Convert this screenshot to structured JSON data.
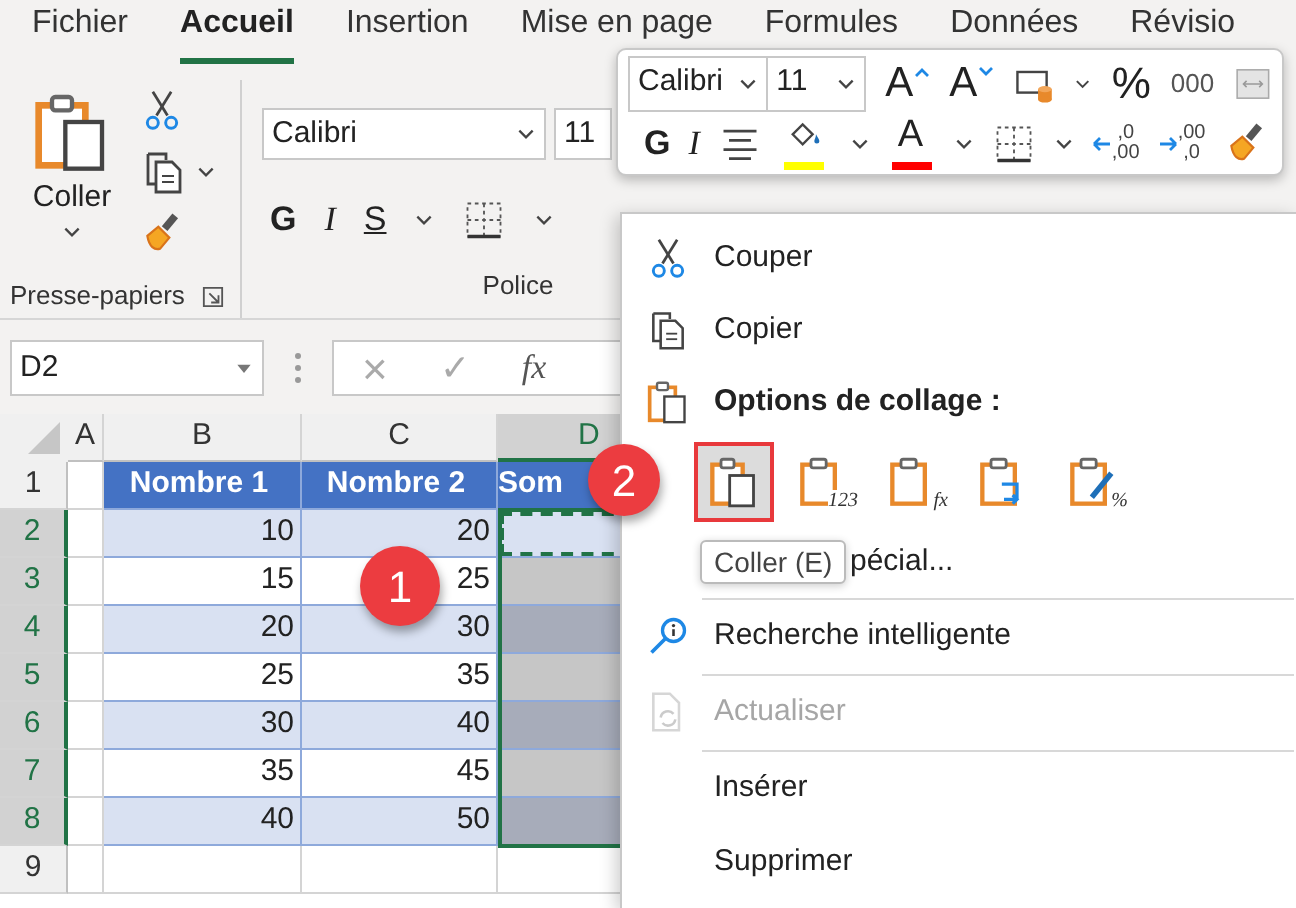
{
  "ribbon_tabs": [
    {
      "label": "Fichier",
      "selected": false
    },
    {
      "label": "Accueil",
      "selected": true
    },
    {
      "label": "Insertion",
      "selected": false
    },
    {
      "label": "Mise en page",
      "selected": false
    },
    {
      "label": "Formules",
      "selected": false
    },
    {
      "label": "Données",
      "selected": false
    },
    {
      "label": "Révisio",
      "selected": false
    }
  ],
  "clipboard_group": {
    "paste_label": "Coller",
    "label": "Presse-papiers"
  },
  "font_group": {
    "font": "Calibri",
    "size": "11",
    "bold": "G",
    "italic": "I",
    "underline": "S",
    "label": "Police"
  },
  "formula_bar": {
    "name_box": "D2",
    "cancel": "×",
    "enter": "✓",
    "function": "fx"
  },
  "sheet": {
    "columns": [
      {
        "label": "A",
        "selected": false
      },
      {
        "label": "B",
        "selected": false
      },
      {
        "label": "C",
        "selected": false
      },
      {
        "label": "D",
        "selected": true
      }
    ],
    "rows": [
      {
        "kind": "header",
        "number": "1",
        "selected": false,
        "copied": false,
        "cells": [
          "Nombre 1",
          "Nombre 2",
          "Som"
        ]
      },
      {
        "kind": "data",
        "number": "2",
        "selected": true,
        "copied": true,
        "cells": [
          "10",
          "20"
        ]
      },
      {
        "kind": "data",
        "number": "3",
        "selected": true,
        "copied": false,
        "cells": [
          "15",
          "25"
        ]
      },
      {
        "kind": "data",
        "number": "4",
        "selected": true,
        "copied": false,
        "cells": [
          "20",
          "30"
        ]
      },
      {
        "kind": "data",
        "number": "5",
        "selected": true,
        "copied": false,
        "cells": [
          "25",
          "35"
        ]
      },
      {
        "kind": "data",
        "number": "6",
        "selected": true,
        "copied": false,
        "cells": [
          "30",
          "40"
        ]
      },
      {
        "kind": "data",
        "number": "7",
        "selected": true,
        "copied": false,
        "cells": [
          "35",
          "45"
        ]
      },
      {
        "kind": "data",
        "number": "8",
        "selected": true,
        "copied": false,
        "cells": [
          "40",
          "50"
        ]
      },
      {
        "kind": "empty",
        "number": "9",
        "selected": false,
        "copied": false
      }
    ]
  },
  "mini_toolbar": {
    "font": "Calibri",
    "size": "11",
    "row1": [
      {
        "kind": "grow",
        "label": "A"
      },
      {
        "kind": "shrink",
        "label": "A"
      },
      {
        "kind": "number-format"
      },
      {
        "kind": "caret"
      },
      {
        "kind": "text",
        "label": "%"
      },
      {
        "kind": "small-text",
        "label": "000"
      },
      {
        "kind": "merge"
      }
    ],
    "row2": [
      {
        "kind": "bold",
        "label": "G"
      },
      {
        "kind": "italic",
        "label": "I"
      },
      {
        "kind": "align"
      },
      {
        "kind": "fill",
        "color": "#ffff00"
      },
      {
        "kind": "caret"
      },
      {
        "kind": "font-color",
        "label": "A",
        "color": "#ff0000"
      },
      {
        "kind": "caret"
      },
      {
        "kind": "borders"
      },
      {
        "kind": "caret"
      },
      {
        "kind": "decimal-more",
        "labels": [
          ",0",
          ",00"
        ]
      },
      {
        "kind": "decimal-less",
        "labels": [
          ",00",
          ",0"
        ]
      },
      {
        "kind": "painter"
      }
    ]
  },
  "context_menu": {
    "items": [
      {
        "kind": "cut",
        "label": "Couper",
        "disabled": false
      },
      {
        "kind": "copy",
        "label": "Copier",
        "disabled": false
      },
      {
        "kind": "heading",
        "label": "Options de collage :"
      }
    ],
    "paste_options": [
      {
        "kind": "paste",
        "selected": true
      },
      {
        "kind": "values",
        "label": "123",
        "selected": false
      },
      {
        "kind": "formulas",
        "label": "fx",
        "selected": false
      },
      {
        "kind": "transpose",
        "selected": false
      },
      {
        "kind": "formatting",
        "label": "%",
        "selected": false
      }
    ],
    "more_items": [
      {
        "kind": "special",
        "label": "pécial...",
        "disabled": false,
        "divider_above": false
      },
      {
        "kind": "search",
        "label": "Recherche intelligente",
        "disabled": false,
        "divider_above": true
      },
      {
        "kind": "refresh",
        "label": "Actualiser",
        "disabled": true,
        "divider_above": true
      },
      {
        "kind": "plain",
        "label": "Insérer",
        "disabled": false,
        "divider_above": true
      },
      {
        "kind": "plain",
        "label": "Supprimer",
        "disabled": false,
        "divider_above": false
      }
    ]
  },
  "tooltip": {
    "text": "Coller (E)"
  },
  "callouts": [
    {
      "label": "1"
    },
    {
      "label": "2"
    }
  ]
}
